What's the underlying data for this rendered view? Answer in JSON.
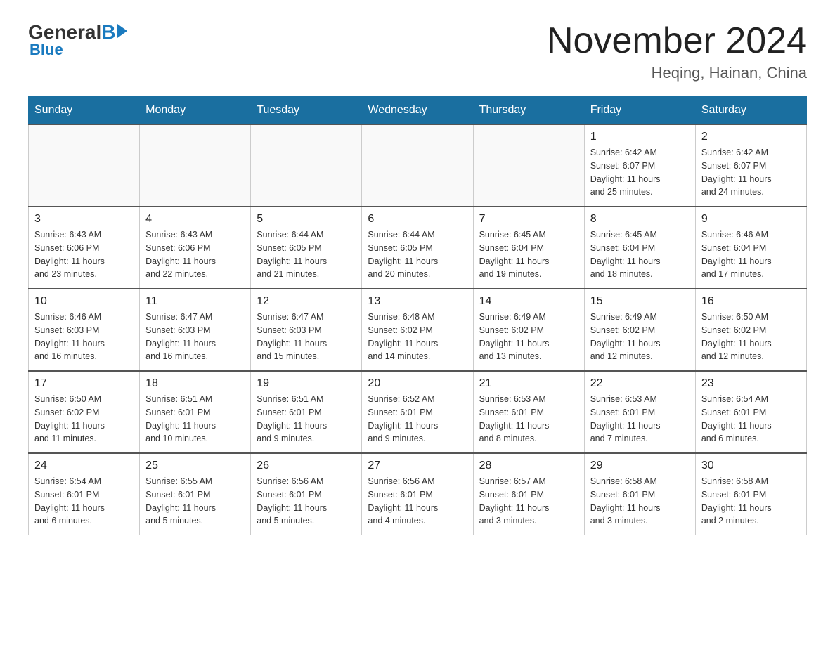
{
  "header": {
    "logo_general": "General",
    "logo_blue": "Blue",
    "month": "November 2024",
    "location": "Heqing, Hainan, China"
  },
  "days_of_week": [
    "Sunday",
    "Monday",
    "Tuesday",
    "Wednesday",
    "Thursday",
    "Friday",
    "Saturday"
  ],
  "weeks": [
    [
      {
        "day": "",
        "info": ""
      },
      {
        "day": "",
        "info": ""
      },
      {
        "day": "",
        "info": ""
      },
      {
        "day": "",
        "info": ""
      },
      {
        "day": "",
        "info": ""
      },
      {
        "day": "1",
        "info": "Sunrise: 6:42 AM\nSunset: 6:07 PM\nDaylight: 11 hours\nand 25 minutes."
      },
      {
        "day": "2",
        "info": "Sunrise: 6:42 AM\nSunset: 6:07 PM\nDaylight: 11 hours\nand 24 minutes."
      }
    ],
    [
      {
        "day": "3",
        "info": "Sunrise: 6:43 AM\nSunset: 6:06 PM\nDaylight: 11 hours\nand 23 minutes."
      },
      {
        "day": "4",
        "info": "Sunrise: 6:43 AM\nSunset: 6:06 PM\nDaylight: 11 hours\nand 22 minutes."
      },
      {
        "day": "5",
        "info": "Sunrise: 6:44 AM\nSunset: 6:05 PM\nDaylight: 11 hours\nand 21 minutes."
      },
      {
        "day": "6",
        "info": "Sunrise: 6:44 AM\nSunset: 6:05 PM\nDaylight: 11 hours\nand 20 minutes."
      },
      {
        "day": "7",
        "info": "Sunrise: 6:45 AM\nSunset: 6:04 PM\nDaylight: 11 hours\nand 19 minutes."
      },
      {
        "day": "8",
        "info": "Sunrise: 6:45 AM\nSunset: 6:04 PM\nDaylight: 11 hours\nand 18 minutes."
      },
      {
        "day": "9",
        "info": "Sunrise: 6:46 AM\nSunset: 6:04 PM\nDaylight: 11 hours\nand 17 minutes."
      }
    ],
    [
      {
        "day": "10",
        "info": "Sunrise: 6:46 AM\nSunset: 6:03 PM\nDaylight: 11 hours\nand 16 minutes."
      },
      {
        "day": "11",
        "info": "Sunrise: 6:47 AM\nSunset: 6:03 PM\nDaylight: 11 hours\nand 16 minutes."
      },
      {
        "day": "12",
        "info": "Sunrise: 6:47 AM\nSunset: 6:03 PM\nDaylight: 11 hours\nand 15 minutes."
      },
      {
        "day": "13",
        "info": "Sunrise: 6:48 AM\nSunset: 6:02 PM\nDaylight: 11 hours\nand 14 minutes."
      },
      {
        "day": "14",
        "info": "Sunrise: 6:49 AM\nSunset: 6:02 PM\nDaylight: 11 hours\nand 13 minutes."
      },
      {
        "day": "15",
        "info": "Sunrise: 6:49 AM\nSunset: 6:02 PM\nDaylight: 11 hours\nand 12 minutes."
      },
      {
        "day": "16",
        "info": "Sunrise: 6:50 AM\nSunset: 6:02 PM\nDaylight: 11 hours\nand 12 minutes."
      }
    ],
    [
      {
        "day": "17",
        "info": "Sunrise: 6:50 AM\nSunset: 6:02 PM\nDaylight: 11 hours\nand 11 minutes."
      },
      {
        "day": "18",
        "info": "Sunrise: 6:51 AM\nSunset: 6:01 PM\nDaylight: 11 hours\nand 10 minutes."
      },
      {
        "day": "19",
        "info": "Sunrise: 6:51 AM\nSunset: 6:01 PM\nDaylight: 11 hours\nand 9 minutes."
      },
      {
        "day": "20",
        "info": "Sunrise: 6:52 AM\nSunset: 6:01 PM\nDaylight: 11 hours\nand 9 minutes."
      },
      {
        "day": "21",
        "info": "Sunrise: 6:53 AM\nSunset: 6:01 PM\nDaylight: 11 hours\nand 8 minutes."
      },
      {
        "day": "22",
        "info": "Sunrise: 6:53 AM\nSunset: 6:01 PM\nDaylight: 11 hours\nand 7 minutes."
      },
      {
        "day": "23",
        "info": "Sunrise: 6:54 AM\nSunset: 6:01 PM\nDaylight: 11 hours\nand 6 minutes."
      }
    ],
    [
      {
        "day": "24",
        "info": "Sunrise: 6:54 AM\nSunset: 6:01 PM\nDaylight: 11 hours\nand 6 minutes."
      },
      {
        "day": "25",
        "info": "Sunrise: 6:55 AM\nSunset: 6:01 PM\nDaylight: 11 hours\nand 5 minutes."
      },
      {
        "day": "26",
        "info": "Sunrise: 6:56 AM\nSunset: 6:01 PM\nDaylight: 11 hours\nand 5 minutes."
      },
      {
        "day": "27",
        "info": "Sunrise: 6:56 AM\nSunset: 6:01 PM\nDaylight: 11 hours\nand 4 minutes."
      },
      {
        "day": "28",
        "info": "Sunrise: 6:57 AM\nSunset: 6:01 PM\nDaylight: 11 hours\nand 3 minutes."
      },
      {
        "day": "29",
        "info": "Sunrise: 6:58 AM\nSunset: 6:01 PM\nDaylight: 11 hours\nand 3 minutes."
      },
      {
        "day": "30",
        "info": "Sunrise: 6:58 AM\nSunset: 6:01 PM\nDaylight: 11 hours\nand 2 minutes."
      }
    ]
  ]
}
